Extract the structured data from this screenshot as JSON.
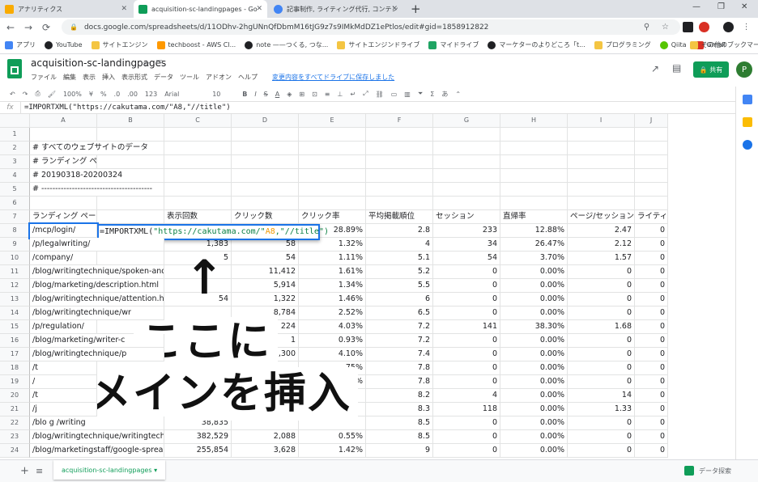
{
  "browser": {
    "tabs": [
      {
        "title": "アナリティクス",
        "color": "#f9ab00"
      },
      {
        "title": "acquisition-sc-landingpages - Go",
        "color": "#0f9d58"
      },
      {
        "title": "記事制作, ライティング代行, コンテン",
        "color": "#4285f4"
      }
    ],
    "url": "docs.google.com/spreadsheets/d/11ODhv-2hgUNnQfDbmM16tJG9z7s9IMkMdDZ1ePtlos/edit#gid=1858912822",
    "bookmarks": [
      "アプリ",
      "YouTube",
      "サイトエンジン",
      "techboost - AWS Cl...",
      "note ——つくる, つな...",
      "サイトエンジンドライブ",
      "マイドライブ",
      "マーケターのよりどころ「t...",
      "プログラミング",
      "Qiita",
      "Gmail"
    ],
    "other_bookmarks": "その他のブックマーク"
  },
  "doc": {
    "title": "acquisition-sc-landingpages",
    "menu": [
      "ファイル",
      "編集",
      "表示",
      "挿入",
      "表示形式",
      "データ",
      "ツール",
      "アドオン",
      "ヘルプ"
    ],
    "save_status": "変更内容をすべてドライブに保存しました",
    "share": "共有",
    "avatar": "P"
  },
  "format_toolbar": {
    "zoom": "100%",
    "currency": "¥",
    "percent": "%",
    "decimals_down": ".0",
    "decimals_up": ".00",
    "format": "123",
    "font": "Arial",
    "size": "10",
    "bold": "B",
    "italic": "I",
    "strike": "S",
    "text_color": "A"
  },
  "formula_bar": {
    "fx": "fx",
    "value": "=IMPORTXML(\"https://cakutama.com/\"A8,\"//title\")"
  },
  "columns": [
    "A",
    "B",
    "C",
    "D",
    "E",
    "F",
    "G",
    "H",
    "I",
    "J"
  ],
  "rows": [
    {
      "n": "1",
      "a": "",
      "vals": [
        "",
        "",
        "",
        "",
        "",
        "",
        "",
        ""
      ]
    },
    {
      "n": "2",
      "a": "# すべてのウェブサイトのデータ",
      "vals": [
        "",
        "",
        "",
        "",
        "",
        "",
        "",
        ""
      ]
    },
    {
      "n": "3",
      "a": "# ランディング ページ",
      "vals": [
        "",
        "",
        "",
        "",
        "",
        "",
        "",
        ""
      ]
    },
    {
      "n": "4",
      "a": "# 20190318-20200324",
      "vals": [
        "",
        "",
        "",
        "",
        "",
        "",
        "",
        ""
      ]
    },
    {
      "n": "5",
      "a": "# ----------------------------------------",
      "vals": [
        "",
        "",
        "",
        "",
        "",
        "",
        "",
        ""
      ]
    },
    {
      "n": "6",
      "a": "",
      "vals": [
        "",
        "",
        "",
        "",
        "",
        "",
        "",
        ""
      ]
    },
    {
      "n": "7",
      "a": "ランディング ページ",
      "header": true,
      "vals": [
        "表示回数",
        "クリック数",
        "クリック率",
        "平均掲載順位",
        "セッション",
        "直帰率",
        "ページ/セッション",
        "ライティングお問",
        "ライテ"
      ]
    },
    {
      "n": "8",
      "a": "/mcp/login/",
      "vals": [
        "",
        "",
        "28.89%",
        "2.8",
        "233",
        "12.88%",
        "2.47",
        "0"
      ]
    },
    {
      "n": "9",
      "a": "/p/legalwriting/",
      "vals": [
        "1,383",
        "58",
        "1.32%",
        "4",
        "34",
        "26.47%",
        "2.12",
        "0"
      ]
    },
    {
      "n": "10",
      "a": "/company/",
      "vals": [
        "5",
        "54",
        "1.11%",
        "5.1",
        "54",
        "3.70%",
        "1.57",
        "0"
      ]
    },
    {
      "n": "11",
      "a": "/blog/writingtechnique/spoken-and",
      "vals": [
        "",
        "11,412",
        "1.61%",
        "5.2",
        "0",
        "0.00%",
        "0",
        "0"
      ]
    },
    {
      "n": "12",
      "a": "/blog/marketing/description.html",
      "vals": [
        "",
        "5,914",
        "1.34%",
        "5.5",
        "0",
        "0.00%",
        "0",
        "0"
      ]
    },
    {
      "n": "13",
      "a": "/blog/writingtechnique/attention.htr",
      "vals": [
        "54",
        "1,322",
        "1.46%",
        "6",
        "0",
        "0.00%",
        "0",
        "0"
      ]
    },
    {
      "n": "14",
      "a": "/blog/writingtechnique/wr",
      "vals": [
        "",
        "8,784",
        "2.52%",
        "6.5",
        "0",
        "0.00%",
        "0",
        "0"
      ]
    },
    {
      "n": "15",
      "a": "/p/regulation/",
      "vals": [
        "",
        "224",
        "4.03%",
        "7.2",
        "141",
        "38.30%",
        "1.68",
        "0"
      ]
    },
    {
      "n": "16",
      "a": "/blog/marketing/writer-c",
      "vals": [
        "",
        "1",
        "0.93%",
        "7.2",
        "0",
        "0.00%",
        "0",
        "0"
      ]
    },
    {
      "n": "17",
      "a": "/blog/writingtechnique/p",
      "vals": [
        "",
        "1,300",
        "4.10%",
        "7.4",
        "0",
        "0.00%",
        "0",
        "0"
      ]
    },
    {
      "n": "18",
      "a": "/t",
      "vals": [
        "",
        "",
        "75%",
        "7.8",
        "0",
        "0.00%",
        "0",
        "0"
      ]
    },
    {
      "n": "19",
      "a": "/",
      "vals": [
        "",
        "",
        "%",
        "7.8",
        "0",
        "0.00%",
        "0",
        "0"
      ]
    },
    {
      "n": "20",
      "a": "/t",
      "vals": [
        "",
        "",
        "",
        "8.2",
        "4",
        "0.00%",
        "14",
        "0"
      ]
    },
    {
      "n": "21",
      "a": "/j",
      "vals": [
        "",
        "",
        "",
        "8.3",
        "118",
        "0.00%",
        "1.33",
        "0"
      ]
    },
    {
      "n": "22",
      "a": "/blo        g      /writing",
      "vals": [
        "38,835",
        "",
        "",
        "8.5",
        "0",
        "0.00%",
        "0",
        "0"
      ]
    },
    {
      "n": "23",
      "a": "/blog/writingtechnique/writingtechn",
      "vals": [
        "382,529",
        "2,088",
        "0.55%",
        "8.5",
        "0",
        "0.00%",
        "0",
        "0"
      ]
    },
    {
      "n": "24",
      "a": "/blog/marketingstaff/google-spreac",
      "vals": [
        "255,854",
        "3,628",
        "1.42%",
        "9",
        "0",
        "0.00%",
        "0",
        "0"
      ]
    }
  ],
  "editor": {
    "prefix": "=IMPORTXML(",
    "str": "\"https://cakutama.com/\"",
    "ref": "A8",
    "suffix": ",\"//title\")"
  },
  "overlay": {
    "arrow": "↑",
    "line1": "ここに",
    "line2": "ドメインを挿入"
  },
  "sheet": {
    "tab": "acquisition-sc-landingpages",
    "explore": "データ探索"
  }
}
